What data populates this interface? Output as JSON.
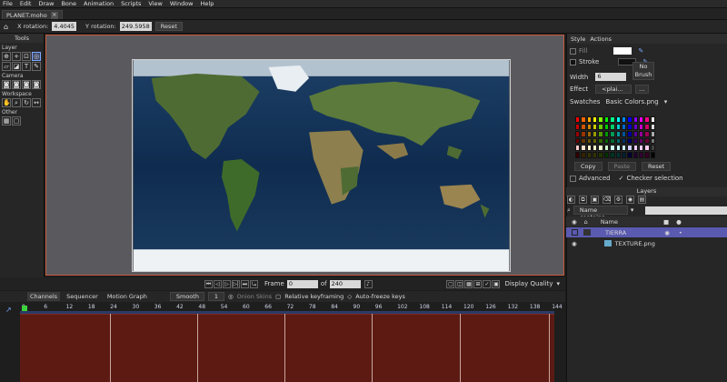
{
  "menu": [
    "File",
    "Edit",
    "Draw",
    "Bone",
    "Animation",
    "Scripts",
    "View",
    "Window",
    "Help"
  ],
  "doc_tab": {
    "title": "PLANET.moho",
    "close": "×"
  },
  "tool_options": {
    "x_label": "X rotation:",
    "x_value": "4.4045",
    "y_label": "Y rotation:",
    "y_value": "249.5958",
    "reset": "Reset"
  },
  "tools": {
    "title": "Tools",
    "layer_label": "Layer",
    "camera_label": "Camera",
    "workspace_label": "Workspace",
    "other_label": "Other"
  },
  "transport": {
    "frame_label": "Frame",
    "frame_value": "0",
    "of_label": "of",
    "total": "240",
    "display_quality": "Display Quality"
  },
  "style": {
    "tab_style": "Style",
    "tab_actions": "Actions",
    "fill": "Fill",
    "stroke": "Stroke",
    "width_label": "Width",
    "width_value": "6",
    "effect_label": "Effect",
    "effect_value": "<plai...",
    "no_brush": "No Brush",
    "swatches_label": "Swatches",
    "swatches_file": "Basic Colors.png",
    "copy": "Copy",
    "paste": "Paste",
    "reset": "Reset",
    "advanced": "Advanced",
    "checker": "Checker selection"
  },
  "layers": {
    "title": "Layers",
    "search_placeholder": "Name contains...",
    "name_col": "Name",
    "items": [
      {
        "name": "TIERRA"
      },
      {
        "name": "TEXTURE.png"
      }
    ]
  },
  "timeline": {
    "tabs": [
      "Channels",
      "Sequencer",
      "Motion Graph"
    ],
    "interp": "Smooth",
    "interp_num": "1",
    "onion": "Onion Skins",
    "relative": "Relative keyframing",
    "autofreeze": "Auto-freeze keys",
    "ruler": [
      "0",
      "6",
      "12",
      "18",
      "24",
      "30",
      "36",
      "42",
      "48",
      "54",
      "60",
      "66",
      "72",
      "78",
      "84",
      "90",
      "96",
      "102",
      "108",
      "114",
      "120",
      "126",
      "132",
      "138",
      "144"
    ]
  },
  "colors": {
    "accent_border": "#c85a3a",
    "selected_layer": "#5a5ab0",
    "track": "#5c1a12"
  }
}
